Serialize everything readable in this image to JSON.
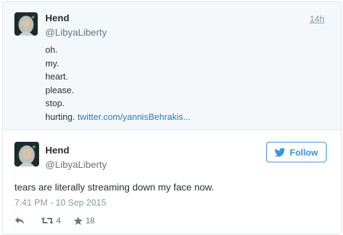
{
  "quoted_tweet": {
    "display_name": "Hend",
    "handle": "@LibyaLiberty",
    "time": "14h",
    "lines": [
      "oh.",
      "my.",
      "heart.",
      "please.",
      "stop."
    ],
    "last_line_text": "hurting.",
    "link_text": "twitter.com/yannisBehrakis..."
  },
  "main_tweet": {
    "display_name": "Hend",
    "handle": "@LibyaLiberty",
    "follow_label": "Follow",
    "text": "tears are literally streaming down my face now.",
    "timestamp": "7:41 PM - 10 Sep 2015",
    "retweet_count": "4",
    "favorite_count": "18"
  },
  "icons": {
    "follow": "twitter-bird-icon",
    "reply": "reply-icon",
    "retweet": "retweet-icon",
    "favorite": "star-icon"
  },
  "colors": {
    "link": "#2b7bb9",
    "follow_accent": "#3b94d9",
    "muted": "#8899a6"
  }
}
